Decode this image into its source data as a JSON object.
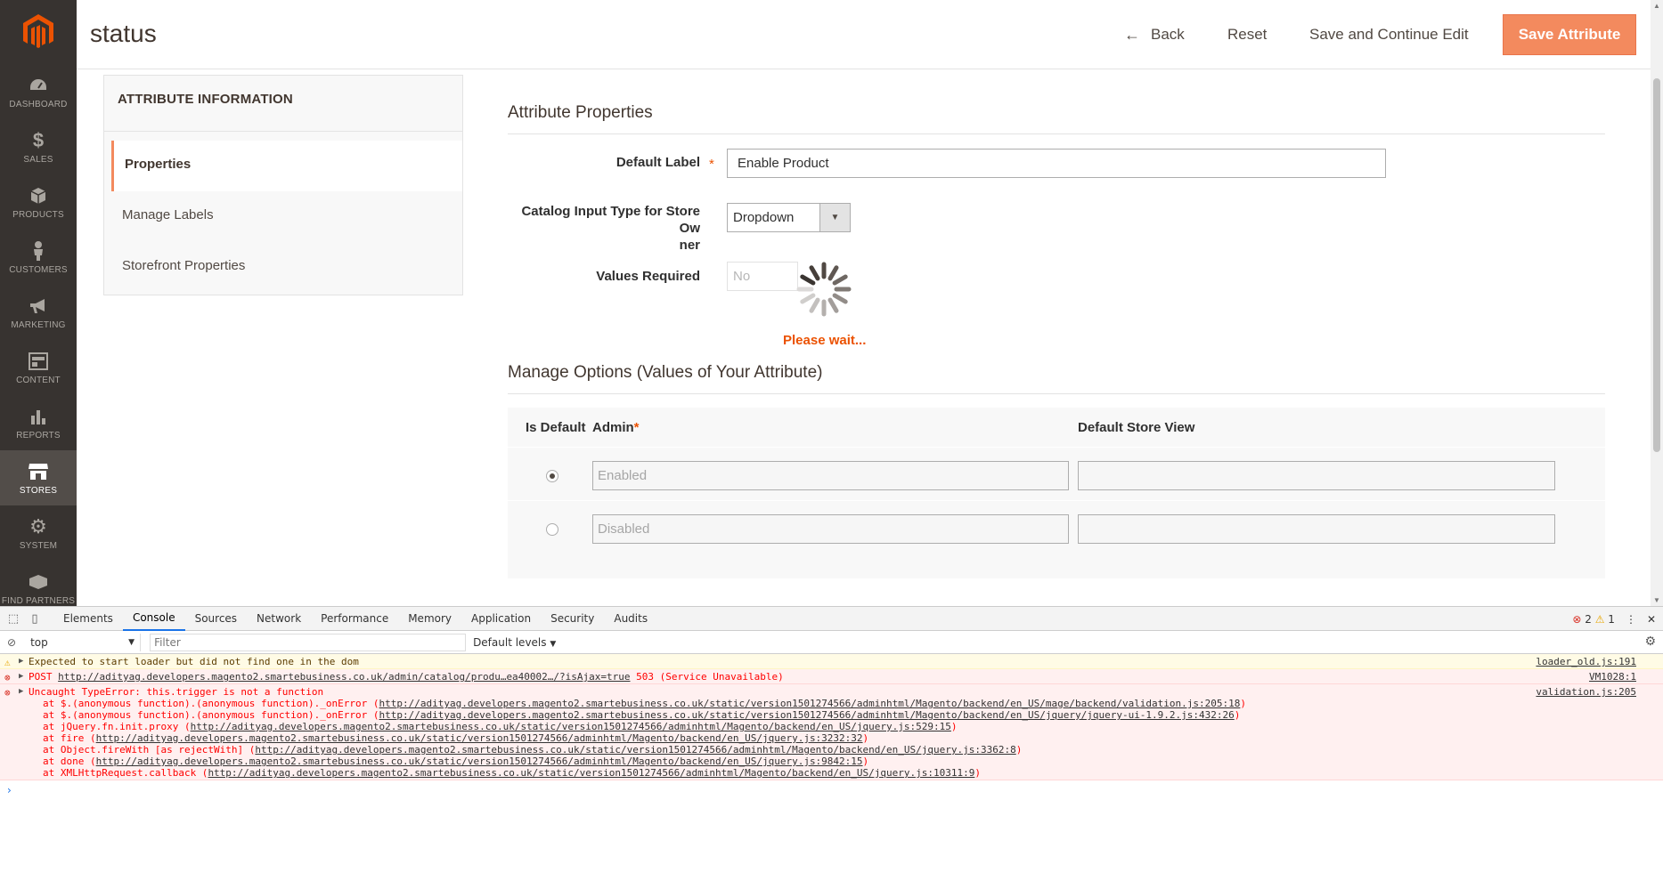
{
  "brand": {
    "accent": "#eb5202",
    "menu_bg": "#373330"
  },
  "admin_menu": [
    {
      "id": "dashboard",
      "label": "DASHBOARD",
      "icon": "dashboard-icon"
    },
    {
      "id": "sales",
      "label": "SALES",
      "icon": "dollar-icon"
    },
    {
      "id": "products",
      "label": "PRODUCTS",
      "icon": "cube-icon"
    },
    {
      "id": "customers",
      "label": "CUSTOMERS",
      "icon": "person-icon"
    },
    {
      "id": "marketing",
      "label": "MARKETING",
      "icon": "megaphone-icon"
    },
    {
      "id": "content",
      "label": "CONTENT",
      "icon": "layout-icon"
    },
    {
      "id": "reports",
      "label": "REPORTS",
      "icon": "bar-chart-icon"
    },
    {
      "id": "stores",
      "label": "STORES",
      "icon": "store-icon",
      "active": true
    },
    {
      "id": "system",
      "label": "SYSTEM",
      "icon": "gear-icon"
    },
    {
      "id": "find_partners",
      "label": "FIND PARTNERS",
      "icon": "partners-icon"
    }
  ],
  "header": {
    "title": "status",
    "back_label": "Back",
    "reset_label": "Reset",
    "save_continue_label": "Save and Continue Edit",
    "save_label": "Save Attribute"
  },
  "tabs": {
    "title": "ATTRIBUTE INFORMATION",
    "items": [
      {
        "label": "Properties",
        "active": true
      },
      {
        "label": "Manage Labels"
      },
      {
        "label": "Storefront Properties"
      }
    ]
  },
  "properties": {
    "section_title": "Attribute Properties",
    "default_label": {
      "label": "Default Label",
      "value": "Enable Product"
    },
    "input_type": {
      "label_line1": "Catalog Input Type for Store Ow",
      "label_line2": "ner",
      "value": "Dropdown"
    },
    "values_required": {
      "label": "Values Required",
      "value": "No"
    }
  },
  "loader": {
    "text": "Please wait..."
  },
  "options": {
    "section_title": "Manage Options (Values of Your Attribute)",
    "col_is_default": "Is Default",
    "col_admin": "Admin",
    "col_admin_required": "*",
    "col_store_view": "Default Store View",
    "rows": [
      {
        "admin": "Enabled",
        "store_view": "",
        "default": true
      },
      {
        "admin": "Disabled",
        "store_view": "",
        "default": false
      }
    ]
  },
  "devtools": {
    "tabs": [
      "Elements",
      "Console",
      "Sources",
      "Network",
      "Performance",
      "Memory",
      "Application",
      "Security",
      "Audits"
    ],
    "active_tab": "Console",
    "error_count": "2",
    "warning_count": "1",
    "context": "top",
    "filter_placeholder": "Filter",
    "levels": "Default levels",
    "messages": {
      "warn": {
        "text": "Expected to start loader but did not find one in the dom",
        "src": "loader_old.js:191"
      },
      "post": {
        "method": "POST",
        "url": "http://adityag.developers.magento2.smartebusiness.co.uk/admin/catalog/produ…ea40002…/?isAjax=true",
        "status": "503 (Service Unavailable)",
        "src": "VM1028:1"
      },
      "uncaught": {
        "text": "Uncaught TypeError: this.trigger is not a function",
        "src": "validation.js:205",
        "stack": [
          {
            "prefix": "at $.(anonymous function).(anonymous function)._onError (",
            "url": "http://adityag.developers.magento2.smartebusiness.co.uk/static/version1501274566/adminhtml/Magento/backend/en_US/mage/backend/validation.js:205:18",
            "suffix": ")"
          },
          {
            "prefix": "at $.(anonymous function).(anonymous function)._onError (",
            "url": "http://adityag.developers.magento2.smartebusiness.co.uk/static/version1501274566/adminhtml/Magento/backend/en_US/jquery/jquery-ui-1.9.2.js:432:26",
            "suffix": ")"
          },
          {
            "prefix": "at jQuery.fn.init.proxy (",
            "url": "http://adityag.developers.magento2.smartebusiness.co.uk/static/version1501274566/adminhtml/Magento/backend/en_US/jquery.js:529:15",
            "suffix": ")"
          },
          {
            "prefix": "at fire (",
            "url": "http://adityag.developers.magento2.smartebusiness.co.uk/static/version1501274566/adminhtml/Magento/backend/en_US/jquery.js:3232:32",
            "suffix": ")"
          },
          {
            "prefix": "at Object.fireWith [as rejectWith] (",
            "url": "http://adityag.developers.magento2.smartebusiness.co.uk/static/version1501274566/adminhtml/Magento/backend/en_US/jquery.js:3362:8",
            "suffix": ")"
          },
          {
            "prefix": "at done (",
            "url": "http://adityag.developers.magento2.smartebusiness.co.uk/static/version1501274566/adminhtml/Magento/backend/en_US/jquery.js:9842:15",
            "suffix": ")"
          },
          {
            "prefix": "at XMLHttpRequest.callback (",
            "url": "http://adityag.developers.magento2.smartebusiness.co.uk/static/version1501274566/adminhtml/Magento/backend/en_US/jquery.js:10311:9",
            "suffix": ")"
          }
        ]
      }
    },
    "prompt": "›"
  }
}
